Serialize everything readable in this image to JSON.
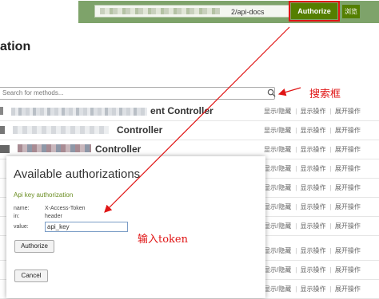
{
  "topbar": {
    "url_value": "2/api-docs",
    "authorize_label": "Authorize",
    "explore_label": "浏览"
  },
  "page": {
    "title": "ation"
  },
  "search": {
    "placeholder": "Search for methods..."
  },
  "controllers": [
    {
      "name": "ent Controller",
      "ops": [
        "显示/隐藏",
        "显示操作",
        "展开操作"
      ]
    },
    {
      "name": "Controller",
      "ops": [
        "显示/隐藏",
        "显示操作",
        "展开操作"
      ]
    },
    {
      "name": "Controller",
      "ops": [
        "显示/隐藏",
        "显示操作",
        "展开操作"
      ]
    },
    {
      "name": "",
      "ops": [
        "显示/隐藏",
        "显示操作",
        "展开操作"
      ]
    },
    {
      "name": "",
      "ops": [
        "显示/隐藏",
        "显示操作",
        "展开操作"
      ]
    },
    {
      "name": "",
      "ops": [
        "显示/隐藏",
        "显示操作",
        "展开操作"
      ]
    },
    {
      "name": "",
      "ops": [
        "显示/隐藏",
        "显示操作",
        "展开操作"
      ]
    },
    {
      "name": "",
      "ops": [
        "显示/隐藏",
        "显示操作",
        "展开操作"
      ]
    },
    {
      "name": "",
      "ops": [
        "显示/隐藏",
        "显示操作",
        "展开操作"
      ]
    },
    {
      "name": "",
      "ops": [
        "显示/隐藏",
        "显示操作",
        "展开操作"
      ]
    }
  ],
  "modal": {
    "title": "Available authorizations",
    "subtitle": "Api key authorization",
    "name_label": "name:",
    "name_value": "X-Access-Token",
    "in_label": "in:",
    "in_value": "header",
    "value_label": "value:",
    "value_input": "api_key",
    "authorize_button": "Authorize",
    "cancel_button": "Cancel"
  },
  "annotations": {
    "search_box": "搜索框",
    "input_token": "输入token"
  },
  "colors": {
    "header_green": "#7ea36a",
    "button_green": "#547f00",
    "annotation_red": "#e01515"
  }
}
